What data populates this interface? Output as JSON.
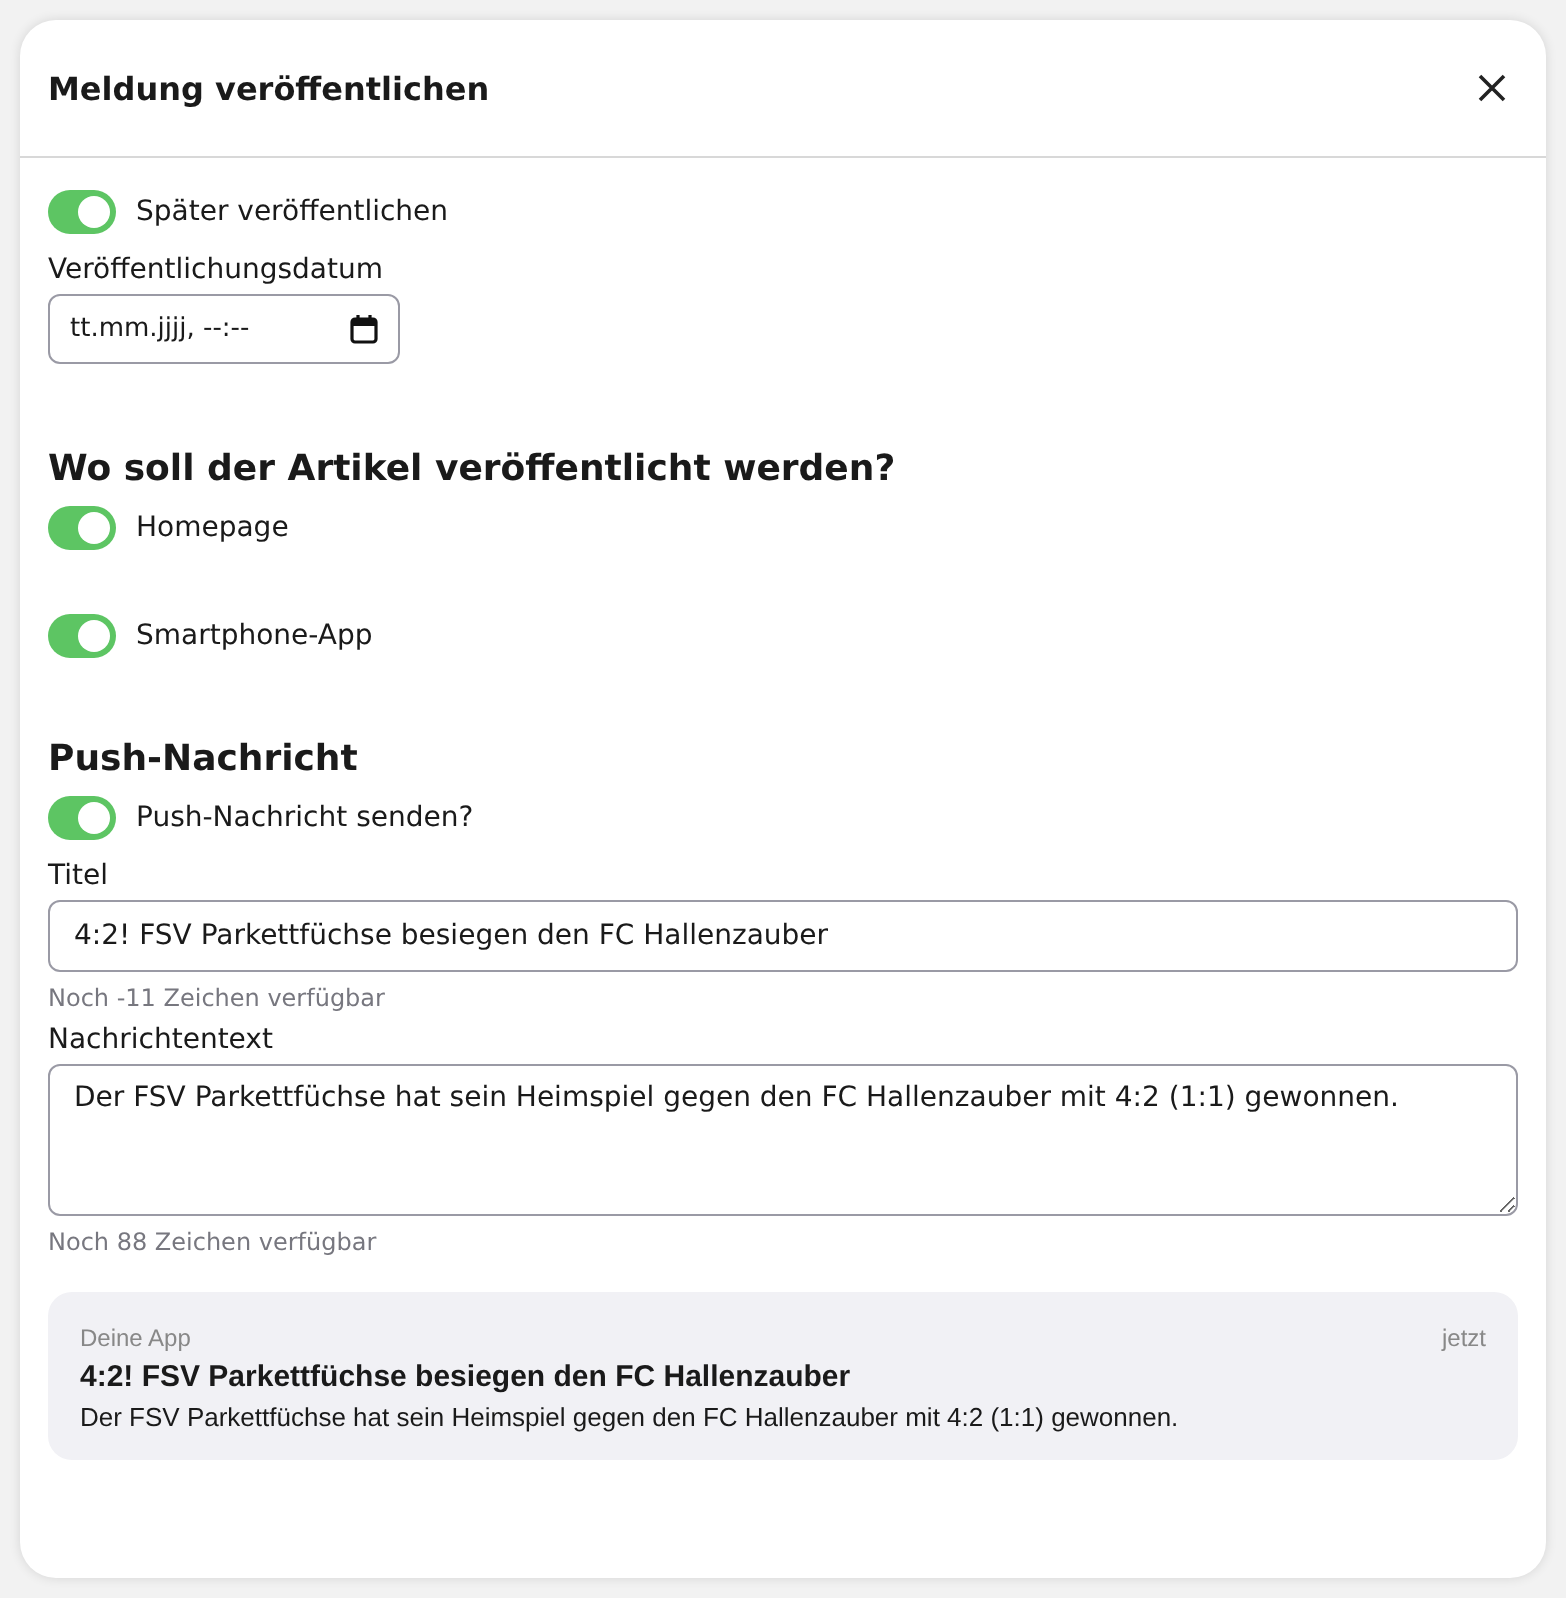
{
  "dialog": {
    "title": "Meldung veröffentlichen"
  },
  "schedule": {
    "toggle": {
      "label": "Später veröffentlichen",
      "on": true
    },
    "date_label": "Veröffentlichungsdatum",
    "date_placeholder": "tt.mm.jjjj, --:--"
  },
  "channels": {
    "heading": "Wo soll der Artikel veröffentlicht werden?",
    "toggles": [
      {
        "label": "Homepage",
        "on": true
      },
      {
        "label": "Smartphone-App",
        "on": true
      }
    ]
  },
  "push": {
    "heading": "Push-Nachricht",
    "toggle": {
      "label": "Push-Nachricht senden?",
      "on": true
    },
    "title_label": "Titel",
    "title_value": "4:2! FSV Parkettfüchse besiegen den FC Hallenzauber",
    "title_hint": "Noch -11 Zeichen verfügbar",
    "text_label": "Nachrichtentext",
    "text_value": "Der FSV Parkettfüchse hat sein Heimspiel gegen den FC Hallenzauber mit 4:2 (1:1) gewonnen.",
    "text_hint": "Noch 88 Zeichen verfügbar"
  },
  "preview": {
    "app": "Deine App",
    "time": "jetzt",
    "title": "4:2! FSV Parkettfüchse besiegen den FC Hallenzauber",
    "body": "Der FSV Parkettfüchse hat sein Heimspiel gegen den FC Hallenzauber mit 4:2 (1:1) gewonnen."
  }
}
